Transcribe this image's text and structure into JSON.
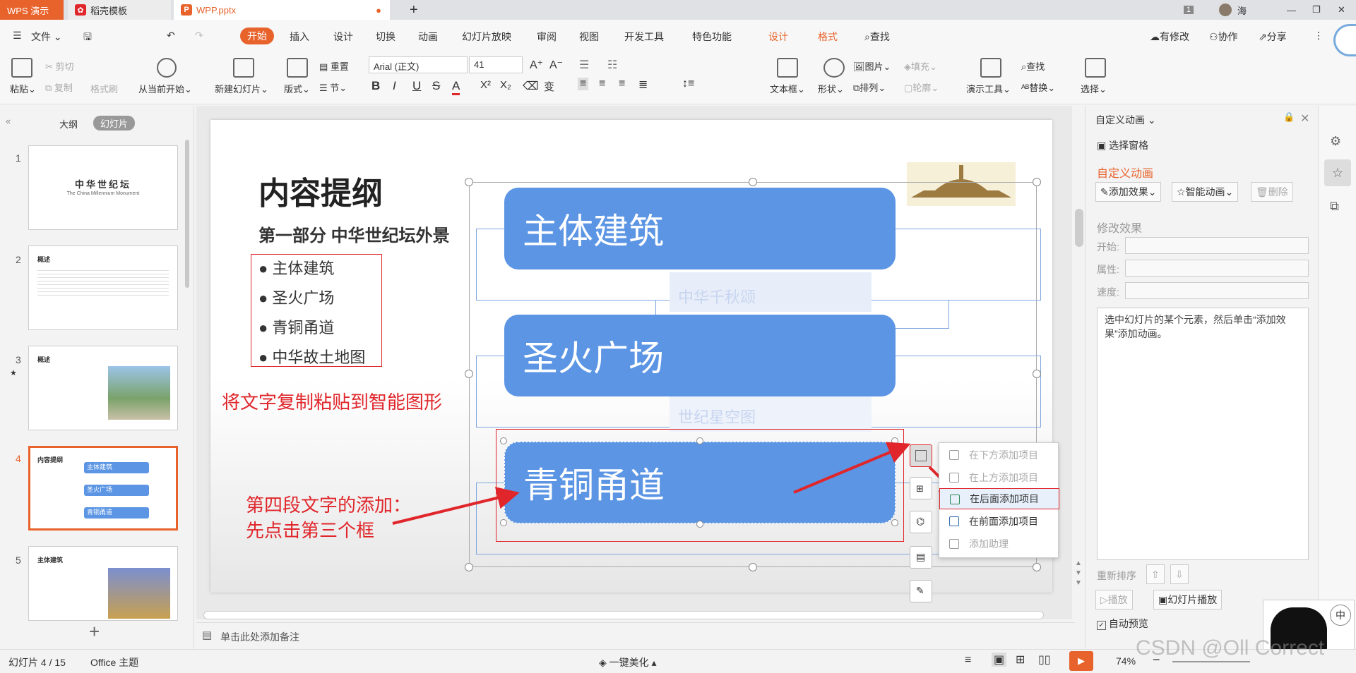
{
  "tabs": {
    "app": "WPS 演示",
    "template": "稻壳模板",
    "file": "WPP.pptx",
    "page_badge": "1",
    "user": "海"
  },
  "menus": {
    "file": "文件",
    "start": "开始",
    "insert": "插入",
    "design": "设计",
    "transition": "切换",
    "animation": "动画",
    "slideshow": "幻灯片放映",
    "review": "审阅",
    "view": "视图",
    "devtools": "开发工具",
    "special": "特色功能",
    "design2": "设计",
    "format": "格式",
    "search": "查找",
    "modified": "有修改",
    "collab": "协作",
    "share": "分享"
  },
  "ribbon": {
    "paste": "粘贴",
    "cut": "剪切",
    "copy": "复制",
    "format_brush": "格式刷",
    "play_from_current": "从当前开始",
    "new_slide": "新建幻灯片",
    "layout": "版式",
    "reset": "重置",
    "section": "节",
    "font_name": "Arial (正文)",
    "font_size": "41",
    "text_box": "文本框",
    "shape": "形状",
    "picture": "图片",
    "fill": "填充",
    "arrange": "排列",
    "outline": "轮廓",
    "presenter_tools": "演示工具",
    "find": "查找",
    "replace": "替换",
    "select": "选择"
  },
  "left_panel": {
    "tab_outline": "大纲",
    "tab_slides": "幻灯片",
    "slide_numbers": [
      "1",
      "2",
      "3",
      "4",
      "5"
    ],
    "thumb1_title": "中华世纪坛",
    "thumb1_sub": "The China Millennium Monument",
    "thumb2_title": "概述",
    "thumb3_title": "概述",
    "thumb4_title": "内容提纲",
    "thumb4_items": [
      "主体建筑",
      "圣火广场",
      "青铜甬道"
    ],
    "thumb5_title": "主体建筑",
    "add": "+"
  },
  "slide": {
    "title": "内容提纲",
    "subtitle": "第一部分 中华世纪坛外景",
    "bullets": [
      "主体建筑",
      "圣火广场",
      "青铜甬道",
      "中华故土地图"
    ],
    "box1": "主体建筑",
    "box1_sub": "中华千秋颂",
    "box2": "圣火广场",
    "box2_sub": "世纪星空图",
    "box3": "青铜甬道"
  },
  "annotations": {
    "a1": "将文字复制粘贴到智能图形",
    "a2_line1": "第四段文字的添加：",
    "a2_line2": "先点击第三个框"
  },
  "popup": {
    "items": [
      "在下方添加项目",
      "在上方添加项目",
      "在后面添加项目",
      "在前面添加项目",
      "添加助理"
    ]
  },
  "right_panel": {
    "header": "自定义动画",
    "selection_pane": "选择窗格",
    "section": "自定义动画",
    "add_effect": "添加效果",
    "smart_anim": "智能动画",
    "delete": "删除",
    "modify": "修改效果",
    "start": "开始:",
    "property": "属性:",
    "speed": "速度:",
    "hint": "选中幻灯片的某个元素，然后单击“添加效果”添加动画。",
    "reorder": "重新排序",
    "play": "播放",
    "slide_play": "幻灯片播放",
    "auto_preview": "自动预览"
  },
  "notes": {
    "placeholder": "单击此处添加备注"
  },
  "status": {
    "slide_info": "幻灯片 4 / 15",
    "theme": "Office 主题",
    "beautify": "一键美化",
    "zoom": "74%"
  },
  "watermark": "CSDN @Oll Correct",
  "colors": {
    "accent": "#e8632c",
    "smartart_blue": "#5b95e4",
    "annotation_red": "#e0262b"
  }
}
